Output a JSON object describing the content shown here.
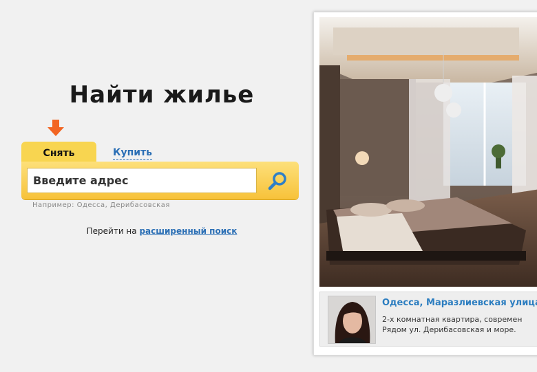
{
  "search": {
    "heading": "Найти жилье",
    "tabs": {
      "rent_label": "Снять",
      "buy_label": "Купить"
    },
    "input_value": "Введите адрес",
    "example": "Например: Одесса, Дерибасовская",
    "advanced_prefix": "Перейти на",
    "advanced_link": "расширенный поиск"
  },
  "colors": {
    "accent_yellow": "#f8d550",
    "arrow_orange": "#f26522",
    "link_blue": "#2b6fb5"
  },
  "listing": {
    "title": "Одесса, Маразлиевская улица",
    "description_line1": "2-х комнатная квартира, современ",
    "description_line2": "Рядом ул. Дерибасовская и море."
  }
}
